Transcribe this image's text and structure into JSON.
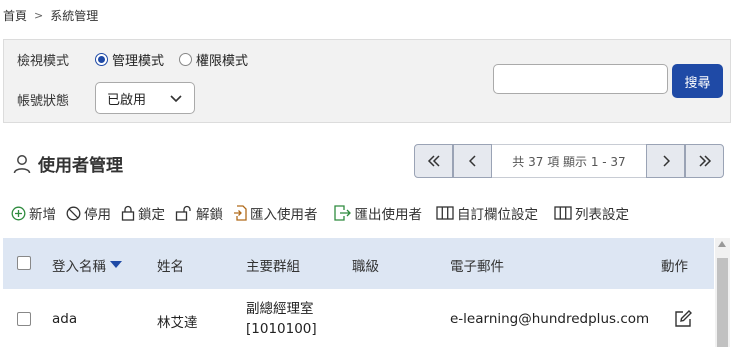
{
  "breadcrumb": {
    "home": "首頁",
    "current": "系統管理"
  },
  "filters": {
    "view_mode_label": "檢視模式",
    "view_mode_options": [
      "管理模式",
      "權限模式"
    ],
    "view_mode_selected": "管理模式",
    "account_status_label": "帳號狀態",
    "account_status_value": "已啟用",
    "search_value": "",
    "search_button": "搜尋"
  },
  "section": {
    "title": "使用者管理"
  },
  "pager": {
    "info": "共 37 項 顯示 1 - 37"
  },
  "toolbar": {
    "add": "新增",
    "disable": "停用",
    "lock": "鎖定",
    "unlock": "解鎖",
    "import": "匯入使用者",
    "export": "匯出使用者",
    "custom_fields": "自訂欄位設定",
    "list_settings": "列表設定"
  },
  "table": {
    "headers": [
      "登入名稱",
      "姓名",
      "主要群組",
      "職級",
      "電子郵件",
      "動作"
    ],
    "rows": [
      {
        "login": "ada",
        "name": "林艾達",
        "group_line1": "副總經理室",
        "group_line2": "[1010100]",
        "rank": "",
        "email": "e-learning@hundredplus.com"
      }
    ]
  },
  "colors": {
    "accent": "#1f4aa6",
    "header_bg": "#dde6f3",
    "panel_bg": "#f2f2f2"
  }
}
